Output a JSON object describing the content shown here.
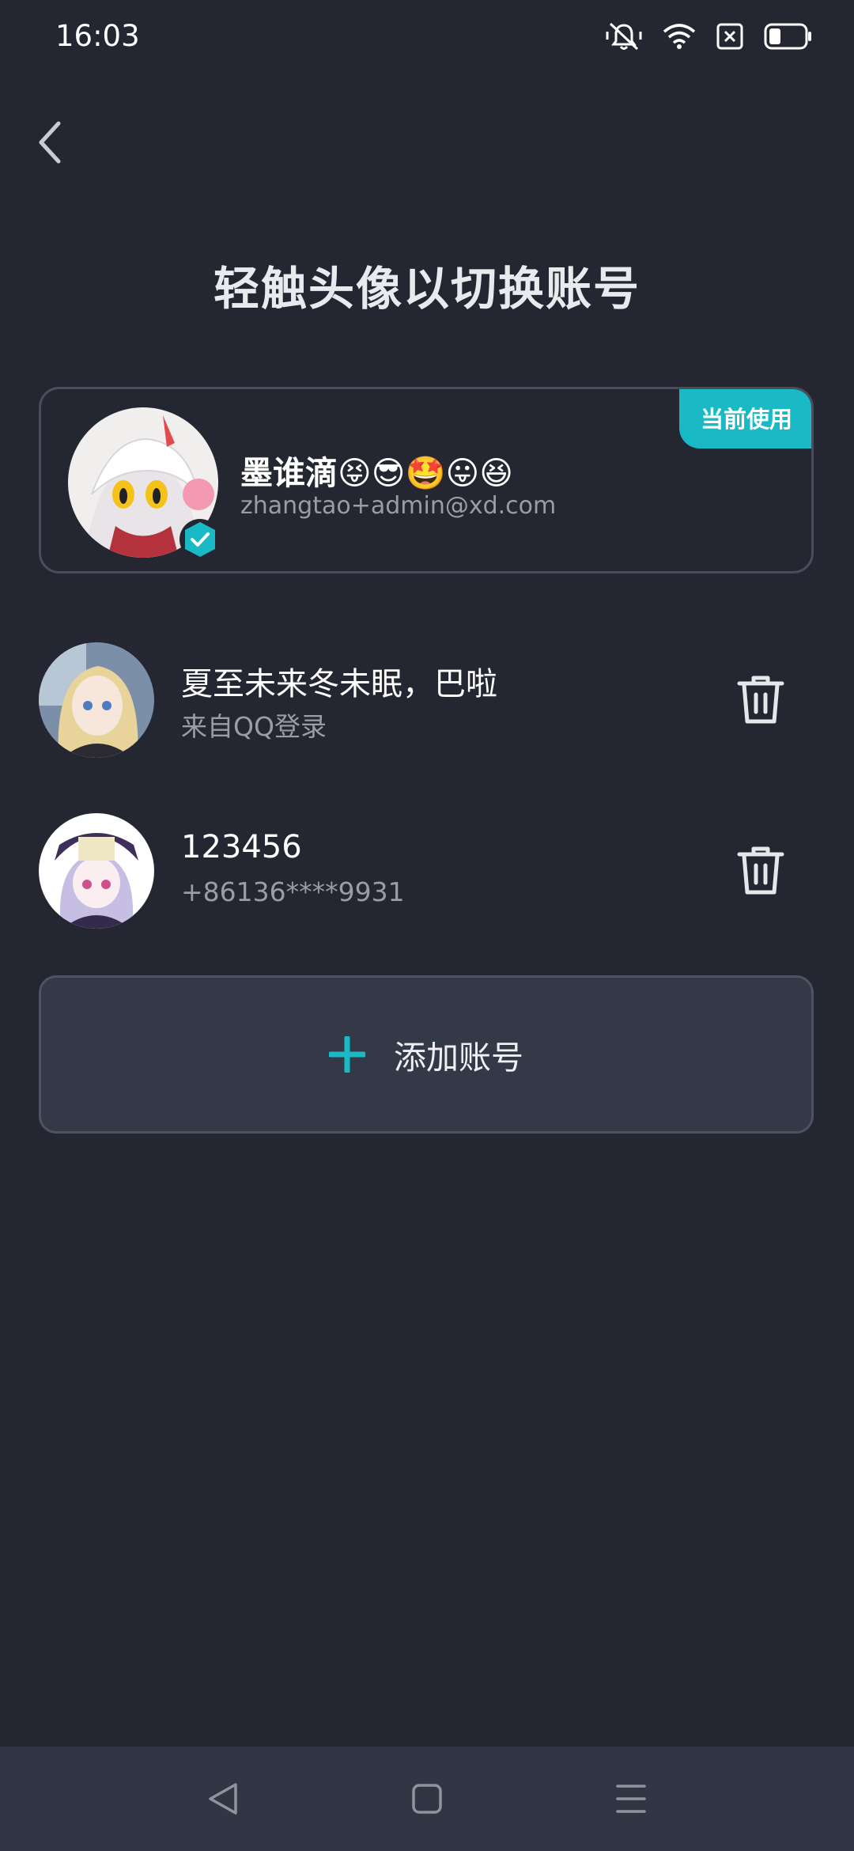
{
  "status_bar": {
    "time": "16:03",
    "icons": [
      "vibrate-bell-icon",
      "wifi-icon",
      "sim-off-icon",
      "battery-icon"
    ]
  },
  "header": {
    "back_icon": "chevron-left-icon",
    "title": "轻触头像以切换账号"
  },
  "current_account": {
    "badge": "当前使用",
    "name": "墨谁滴😝😎🤩😛😆",
    "email": "zhangtao+admin@xd.com",
    "verified_icon": "check-shield-icon"
  },
  "accounts": [
    {
      "name": "夏至未来冬未眠，巴啦",
      "sub": "来自QQ登录",
      "action_icon": "trash-icon"
    },
    {
      "name": "123456",
      "sub": "+86136****9931",
      "action_icon": "trash-icon"
    }
  ],
  "add_account": {
    "label": "添加账号",
    "icon": "plus-icon"
  },
  "nav_bar": {
    "icons": [
      "nav-back-icon",
      "nav-home-icon",
      "nav-menu-icon"
    ]
  },
  "colors": {
    "background": "#242631",
    "accent": "#19b9c6",
    "card_border": "#4a4e5c"
  }
}
